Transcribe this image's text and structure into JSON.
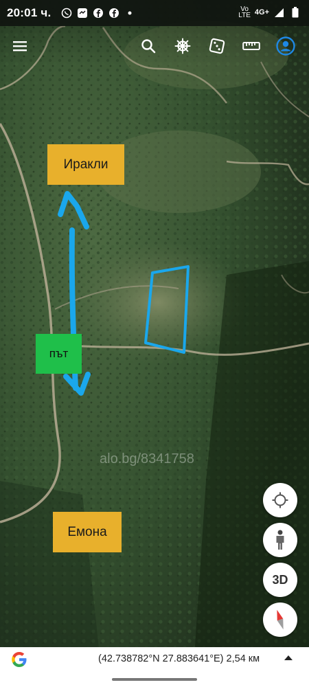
{
  "status_bar": {
    "time": "20:01 ч.",
    "network_top": "Vo",
    "network_bottom": "LTE",
    "signal_label": "4G+",
    "icons": [
      "viber-icon",
      "messenger-icon",
      "facebook-icon",
      "facebook-icon",
      "dot-icon",
      "signal-icon",
      "battery-icon"
    ]
  },
  "toolbar": {
    "icons": [
      "menu-icon",
      "search-icon",
      "ship-wheel-icon",
      "dice-icon",
      "ruler-icon",
      "account-icon"
    ]
  },
  "map": {
    "labels": {
      "north": "Иракли",
      "road": "път",
      "south": "Емона"
    },
    "watermark": "alo.bg/8341758",
    "annotation_color": "#1aa7ec",
    "label_colors": {
      "place": "#e8b02c",
      "road": "#1fbf4a"
    }
  },
  "controls": {
    "three_d_label": "3D",
    "buttons": [
      "locate-icon",
      "street-view-icon",
      "3d-toggle",
      "compass-icon"
    ]
  },
  "bottom_bar": {
    "coordinates": "(42.738782°N 27.883641°E) 2,54 км",
    "logo": "G"
  }
}
